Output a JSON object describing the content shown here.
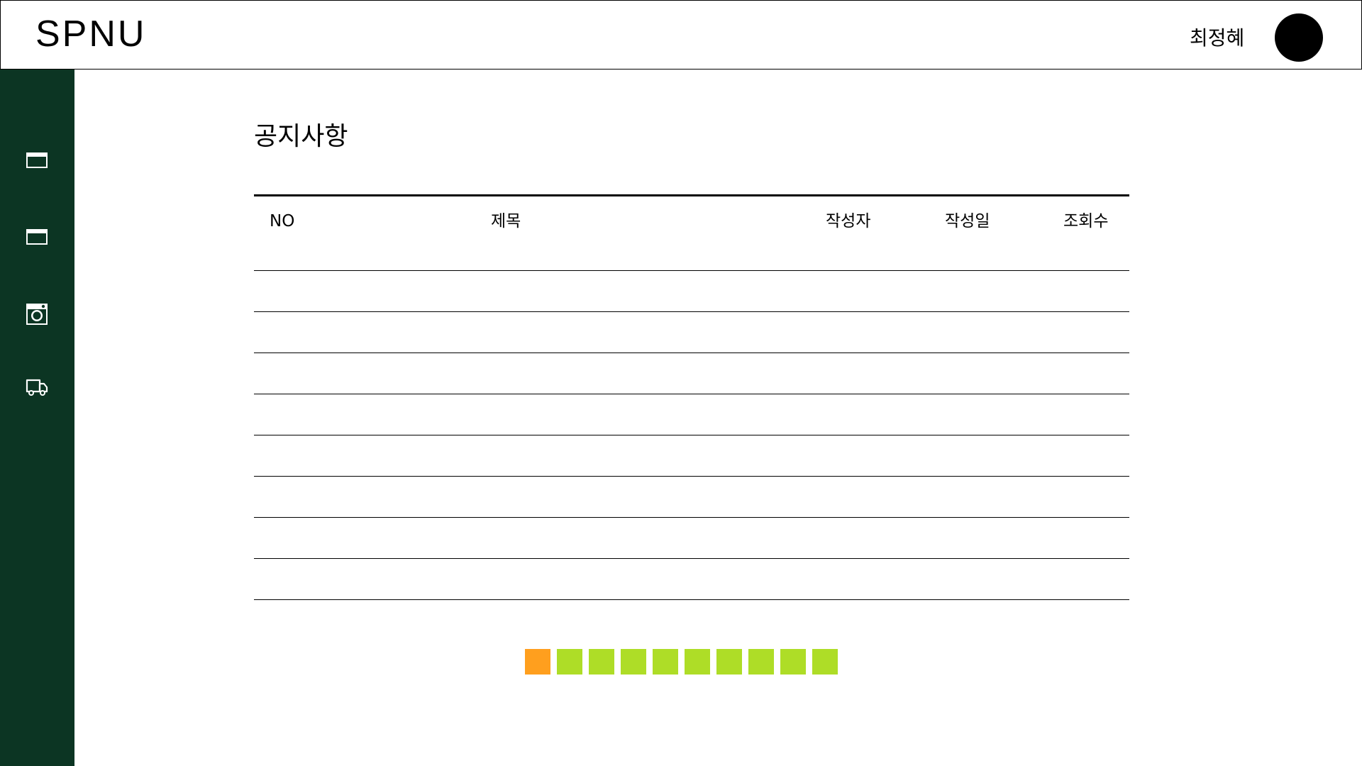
{
  "app": {
    "logo": "SPNU"
  },
  "header": {
    "username": "최정혜"
  },
  "sidebar": {
    "items": [
      {
        "icon": "card-icon"
      },
      {
        "icon": "card-icon"
      },
      {
        "icon": "instagram-icon"
      },
      {
        "icon": "truck-icon"
      }
    ]
  },
  "main": {
    "title": "공지사항",
    "table": {
      "columns": [
        "NO",
        "제목",
        "작성자",
        "작성일",
        "조회수"
      ],
      "rows": [
        [],
        [],
        [],
        [],
        [],
        [],
        [],
        []
      ]
    }
  },
  "pagination": {
    "pages": 10,
    "current": 1
  },
  "colors": {
    "sidebar_bg": "#0c3523",
    "page_active": "#ff9f1e",
    "page_inactive": "#aedd27"
  }
}
